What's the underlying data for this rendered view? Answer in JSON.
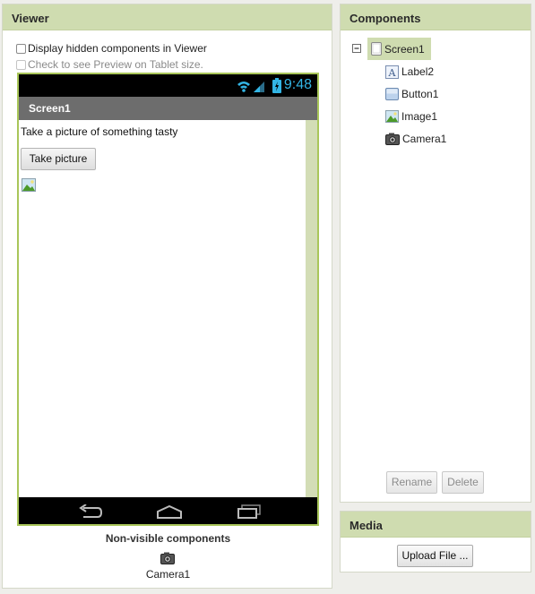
{
  "viewer": {
    "title": "Viewer",
    "display_hidden_label": "Display hidden components in Viewer",
    "tablet_preview_label": "Check to see Preview on Tablet size.",
    "phone": {
      "status_time": "9:48",
      "screen_title": "Screen1",
      "label_text": "Take a picture of something tasty",
      "button_text": "Take picture"
    },
    "nonvisible_title": "Non-visible components",
    "nonvisible_items": [
      "Camera1"
    ]
  },
  "components": {
    "title": "Components",
    "root": "Screen1",
    "children": [
      "Label2",
      "Button1",
      "Image1",
      "Camera1"
    ],
    "rename_label": "Rename",
    "delete_label": "Delete"
  },
  "media": {
    "title": "Media",
    "upload_label": "Upload File ..."
  },
  "colors": {
    "header_bg": "#cfdcb0",
    "phone_border": "#a9c65a",
    "status_accent": "#33b5e5"
  }
}
